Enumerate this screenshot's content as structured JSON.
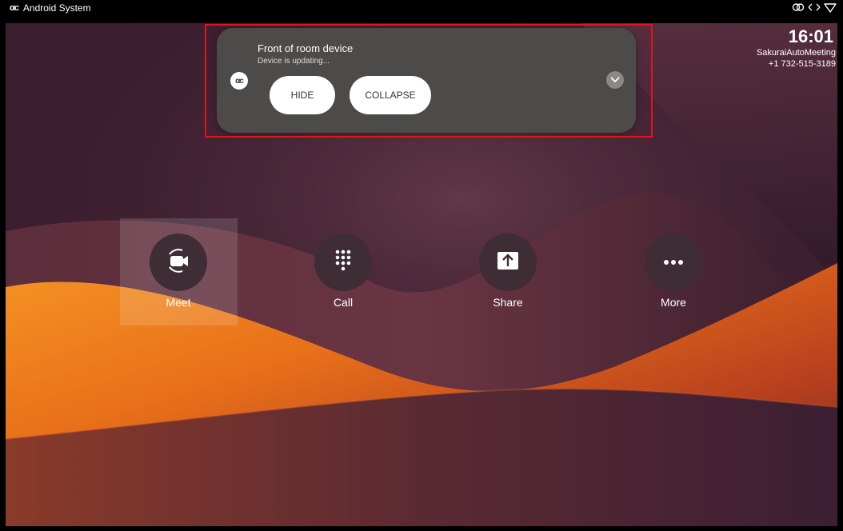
{
  "status_bar": {
    "app_logo": "αc",
    "app_name": "Android System",
    "icons": [
      "link-icon",
      "swap-arrows-icon",
      "wifi-icon"
    ]
  },
  "device": {
    "time": "16:01",
    "name": "SakuraiAutoMeeting",
    "number": "+1 732-515-3189"
  },
  "notification": {
    "app_icon_text": "αc",
    "title": "Front of room device",
    "text": "Device is updating...",
    "buttons": {
      "hide": "HIDE",
      "collapse": "COLLAPSE"
    },
    "expand_icon": "chevron-down-icon",
    "highlight_color": "#e0141e"
  },
  "actions": [
    {
      "label": "Meet",
      "icon": "video-camera-icon",
      "selected": true
    },
    {
      "label": "Call",
      "icon": "dialpad-icon",
      "selected": false
    },
    {
      "label": "Share",
      "icon": "share-up-arrow-icon",
      "selected": false
    },
    {
      "label": "More",
      "icon": "more-dots-icon",
      "selected": false
    }
  ],
  "colors": {
    "notification_bg": "#4c4b49",
    "action_circle": "#3e2d34",
    "wallpaper_orange": "#e8701a",
    "wallpaper_purple": "#4a2637"
  }
}
